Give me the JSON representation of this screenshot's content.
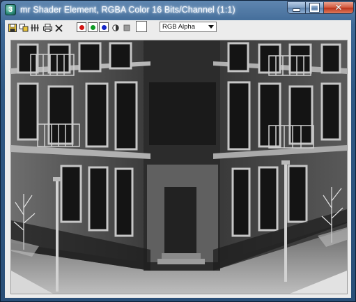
{
  "window": {
    "title": "mr Shader Element, RGBA Color 16 Bits/Channel (1:1)",
    "app_icon_glyph": "3",
    "controls": {
      "minimize_icon": "minimize-icon",
      "maximize_icon": "maximize-icon",
      "close_glyph": "✕"
    }
  },
  "toolbar": {
    "icons": [
      "save-icon",
      "clone-icon",
      "channel-icon",
      "print-icon",
      "clear-icon"
    ],
    "channel_toggles": [
      {
        "name": "red",
        "color": "#d21414"
      },
      {
        "name": "green",
        "color": "#0e9a24"
      },
      {
        "name": "blue",
        "color": "#1426c8"
      }
    ],
    "display_channel": {
      "selected": "RGB Alpha"
    },
    "swatch_color": "#ffffff"
  },
  "render": {
    "subject": "grayscale render of corner apartment building with lamp posts and trees"
  }
}
